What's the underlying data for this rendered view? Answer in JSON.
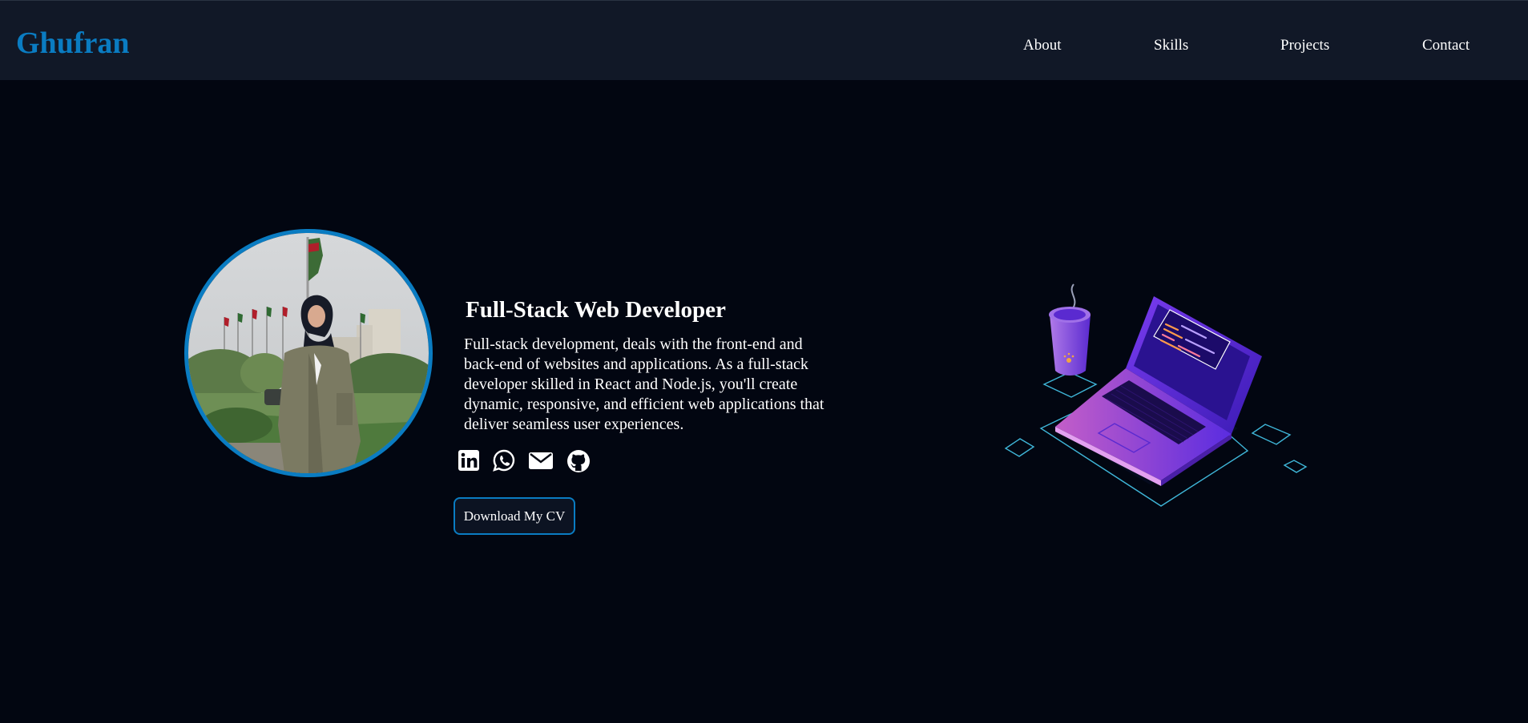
{
  "navbar": {
    "brand": "Ghufran",
    "links": [
      {
        "label": "About"
      },
      {
        "label": "Skills"
      },
      {
        "label": "Projects"
      },
      {
        "label": "Contact"
      }
    ]
  },
  "hero": {
    "headline": "Full-Stack Web Developer",
    "bio": "Full-stack development, deals with the front-end and back-end of websites and applications. As a full-stack developer skilled in React and Node.js, you'll create dynamic, responsive, and efficient web applications that deliver seamless user experiences.",
    "socials": [
      {
        "icon": "linkedin-icon"
      },
      {
        "icon": "whatsapp-icon"
      },
      {
        "icon": "mail-icon"
      },
      {
        "icon": "github-icon"
      }
    ],
    "cv_button": "Download My CV"
  },
  "colors": {
    "background": "#020611",
    "navbar": "#111827",
    "accent": "#0a7cc2",
    "text": "#ffffff"
  }
}
